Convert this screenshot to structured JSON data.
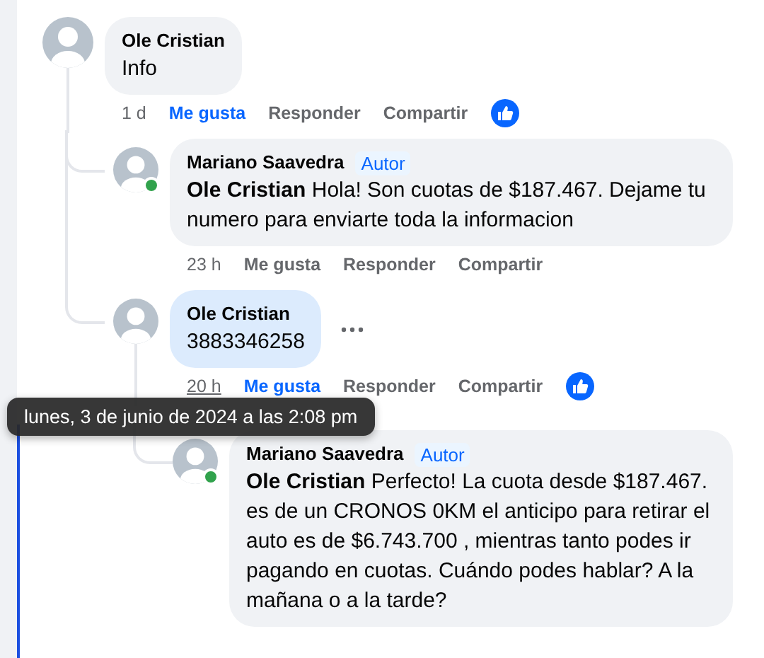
{
  "comments": [
    {
      "author": "Ole Cristian",
      "text": "Info",
      "highlighted": false,
      "online": false,
      "more_menu": false,
      "time": "1 d",
      "time_hovered": false,
      "liked": true,
      "reaction": true,
      "actions": [
        "Me gusta",
        "Responder",
        "Compartir"
      ],
      "children": [
        {
          "author": "Mariano Saavedra",
          "badge": "Autor",
          "text": "**Ole Cristian** Hola! Son cuotas de $187.467. Dejame tu numero para enviarte toda la informacion",
          "highlighted": false,
          "online": true,
          "more_menu": false,
          "time": "23 h",
          "time_hovered": false,
          "liked": false,
          "reaction": false,
          "actions": [
            "Me gusta",
            "Responder",
            "Compartir"
          ]
        },
        {
          "author": "Ole Cristian",
          "text": "3883346258",
          "highlighted": true,
          "online": false,
          "more_menu": true,
          "time": "20 h",
          "time_hovered": true,
          "liked": true,
          "reaction": true,
          "actions": [
            "Me gusta",
            "Responder",
            "Compartir"
          ],
          "children": [
            {
              "author": "Mariano Saavedra",
              "badge": "Autor",
              "text": "**Ole Cristian** Perfecto! La cuota desde $187.467. es de un CRONOS 0KM el anticipo para retirar el auto es de $6.743.700 , mientras tanto podes ir pagando en cuotas. Cuándo podes hablar? A la mañana o a la tarde?",
              "highlighted": false,
              "online": true,
              "more_menu": false
            }
          ]
        }
      ]
    }
  ],
  "tooltip": {
    "text": "lunes, 3 de junio de 2024 a las 2:08 pm"
  }
}
